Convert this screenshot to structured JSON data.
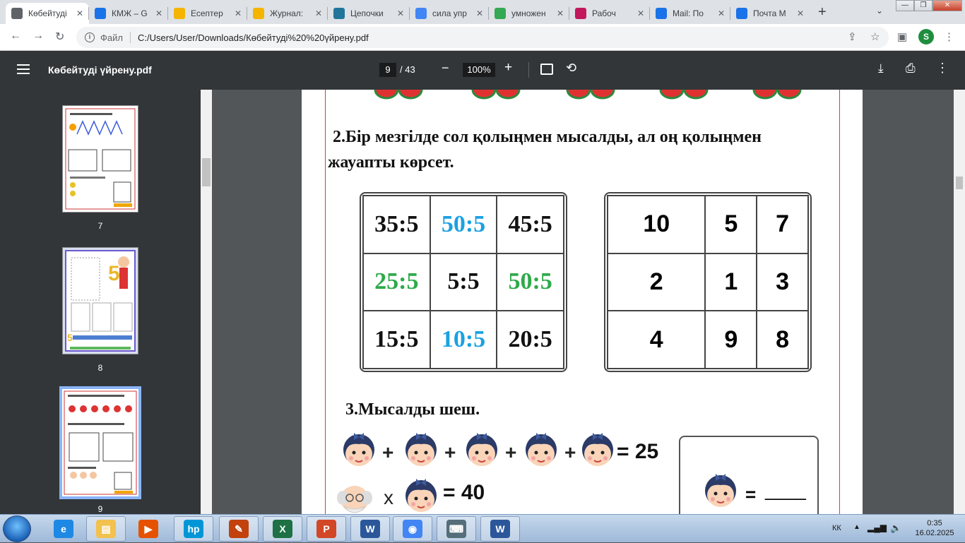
{
  "browser": {
    "tabs": [
      {
        "title": "Көбейтуді",
        "color": "#5f6368",
        "icon": "globe-icon",
        "active": true
      },
      {
        "title": "КМЖ – G",
        "color": "#1a73e8",
        "icon": "google-drive-icon"
      },
      {
        "title": "Есептер",
        "color": "#f4b400",
        "icon": "bulb-icon"
      },
      {
        "title": "Журнал:",
        "color": "#f4b400",
        "icon": "bulb-icon"
      },
      {
        "title": "Цепочки",
        "color": "#21759b",
        "icon": "wordpress-icon"
      },
      {
        "title": "сила упр",
        "color": "#4285f4",
        "icon": "google-icon"
      },
      {
        "title": "умножен",
        "color": "#34a853",
        "icon": "puzzle-icon"
      },
      {
        "title": "Рабоч",
        "color": "#c2185b",
        "icon": "worksheet-icon"
      },
      {
        "title": "Mail: По",
        "color": "#1a73e8",
        "icon": "mail-at-icon"
      },
      {
        "title": "Почта М",
        "color": "#1a73e8",
        "icon": "mail-icon"
      }
    ],
    "new_tab": "+",
    "address": {
      "scheme": "Файл",
      "url": "C:/Users/User/Downloads/Көбейтуді%20%20үйрену.pdf"
    },
    "profile_initial": "S"
  },
  "pdf": {
    "title": "Көбейтуді үйрену.pdf",
    "current_page": "9",
    "total_pages": "/ 43",
    "zoom": "100%",
    "thumbnails": [
      {
        "label": "7"
      },
      {
        "label": "8"
      },
      {
        "label": "9",
        "selected": true
      }
    ]
  },
  "document": {
    "task2_line1": "2.Бір мезгілде сол қолыңмен мысалды, ал оң қолыңмен",
    "task2_line2": "жауапты көрсет.",
    "left_grid": [
      [
        {
          "t": "35:5",
          "c": "#111"
        },
        {
          "t": "50:5",
          "c": "#1ba1e2"
        },
        {
          "t": "45:5",
          "c": "#111"
        }
      ],
      [
        {
          "t": "25:5",
          "c": "#2eaa4a"
        },
        {
          "t": "5:5",
          "c": "#111"
        },
        {
          "t": "50:5",
          "c": "#2eaa4a"
        }
      ],
      [
        {
          "t": "15:5",
          "c": "#111"
        },
        {
          "t": "10:5",
          "c": "#1ba1e2"
        },
        {
          "t": "20:5",
          "c": "#111"
        }
      ]
    ],
    "right_grid": [
      [
        "10",
        "5",
        "7"
      ],
      [
        "2",
        "1",
        "3"
      ],
      [
        "4",
        "9",
        "8"
      ]
    ],
    "task3": "3.Мысалды шеш.",
    "eq1_result": "= 25",
    "eq2_op": "x",
    "eq2_result": "= 40",
    "answer_eq": "=",
    "answer_blank": "____"
  },
  "taskbar": {
    "language": "КК",
    "time": "0:35",
    "date": "16.02.2025",
    "apps": [
      "ie-icon",
      "explorer-icon",
      "media-icon",
      "hp-icon",
      "paint-icon",
      "excel-icon",
      "presentation-icon",
      "word-icon",
      "chrome-icon",
      "keyboard-icon",
      "word-active-icon"
    ]
  }
}
